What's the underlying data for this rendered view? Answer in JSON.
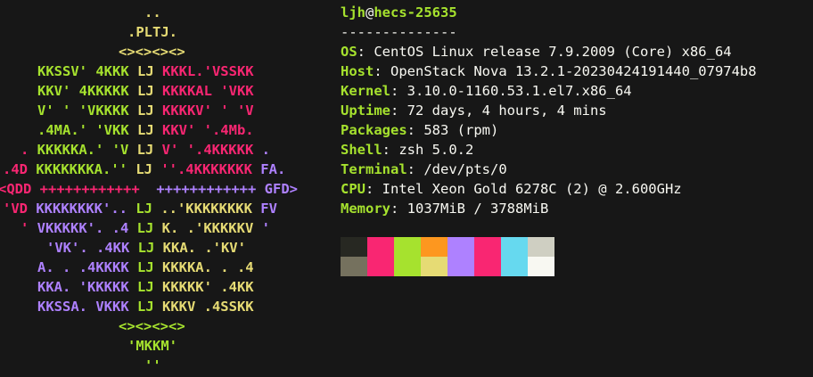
{
  "logo": {
    "lines": [
      {
        "parts": [
          {
            "t": "..",
            "c": "y"
          }
        ]
      },
      {
        "parts": [
          {
            "t": ".PLTJ.",
            "c": "y"
          }
        ]
      },
      {
        "parts": [
          {
            "t": "<><><><>",
            "c": "y"
          }
        ]
      },
      {
        "parts": [
          {
            "t": "KKSSV' 4KKK ",
            "c": "g"
          },
          {
            "t": "LJ ",
            "c": "y"
          },
          {
            "t": "KKKL.'VSSKK",
            "c": "p"
          }
        ]
      },
      {
        "parts": [
          {
            "t": "KKV' 4KKKKK ",
            "c": "g"
          },
          {
            "t": "LJ ",
            "c": "y"
          },
          {
            "t": "KKKKAL 'VKK",
            "c": "p"
          }
        ]
      },
      {
        "parts": [
          {
            "t": "V' ' 'VKKKK ",
            "c": "g"
          },
          {
            "t": "LJ ",
            "c": "y"
          },
          {
            "t": "KKKKV' ' 'V",
            "c": "p"
          }
        ]
      },
      {
        "parts": [
          {
            "t": ".4MA.' 'VKK ",
            "c": "g"
          },
          {
            "t": "LJ ",
            "c": "y"
          },
          {
            "t": "KKV' '.4Mb.",
            "c": "p"
          }
        ]
      },
      {
        "parts": [
          {
            "t": ". ",
            "c": "p"
          },
          {
            "t": "KKKKKA.' 'V ",
            "c": "g"
          },
          {
            "t": "LJ ",
            "c": "y"
          },
          {
            "t": "V' '.4KKKKK ",
            "c": "p"
          },
          {
            "t": ".",
            "c": "v"
          }
        ]
      },
      {
        "parts": [
          {
            "t": ".4D ",
            "c": "p"
          },
          {
            "t": "KKKKKKKA.'' ",
            "c": "g"
          },
          {
            "t": "LJ ",
            "c": "y"
          },
          {
            "t": "''.4KKKKKKK ",
            "c": "p"
          },
          {
            "t": "FA.",
            "c": "v"
          }
        ]
      },
      {
        "parts": [
          {
            "t": "<QDD ",
            "c": "p"
          },
          {
            "t": "++++++++++++  ",
            "c": "p"
          },
          {
            "t": "++++++++++++ ",
            "c": "v"
          },
          {
            "t": "GFD>",
            "c": "v"
          }
        ]
      },
      {
        "parts": [
          {
            "t": "'VD ",
            "c": "p"
          },
          {
            "t": "KKKKKKKK'.. ",
            "c": "v"
          },
          {
            "t": "LJ ",
            "c": "g"
          },
          {
            "t": "..'KKKKKKKK ",
            "c": "y"
          },
          {
            "t": "FV",
            "c": "v"
          }
        ]
      },
      {
        "parts": [
          {
            "t": "' ",
            "c": "p"
          },
          {
            "t": "VKKKKK'. .4 ",
            "c": "v"
          },
          {
            "t": "LJ ",
            "c": "g"
          },
          {
            "t": "K. .'KKKKKV ",
            "c": "y"
          },
          {
            "t": "'",
            "c": "v"
          }
        ]
      },
      {
        "parts": [
          {
            "t": "'VK'. .4KK ",
            "c": "v"
          },
          {
            "t": "LJ ",
            "c": "g"
          },
          {
            "t": "KKA. .'KV'",
            "c": "y"
          }
        ]
      },
      {
        "parts": [
          {
            "t": "A. . .4KKKK ",
            "c": "v"
          },
          {
            "t": "LJ ",
            "c": "g"
          },
          {
            "t": "KKKKA. . .4",
            "c": "y"
          }
        ]
      },
      {
        "parts": [
          {
            "t": "KKA. 'KKKKK ",
            "c": "v"
          },
          {
            "t": "LJ ",
            "c": "g"
          },
          {
            "t": "KKKKK' .4KK",
            "c": "y"
          }
        ]
      },
      {
        "parts": [
          {
            "t": "KKSSA. VKKK ",
            "c": "v"
          },
          {
            "t": "LJ ",
            "c": "g"
          },
          {
            "t": "KKKV .4SSKK",
            "c": "y"
          }
        ]
      },
      {
        "parts": [
          {
            "t": "<><><><>",
            "c": "g"
          }
        ]
      },
      {
        "parts": [
          {
            "t": "'MKKM'",
            "c": "g"
          }
        ]
      },
      {
        "parts": [
          {
            "t": "''",
            "c": "g"
          }
        ]
      }
    ]
  },
  "info": {
    "user": "ljh",
    "at": "@",
    "host": "hecs-25635",
    "separator": "--------------",
    "fields": [
      {
        "key": "OS",
        "value": "CentOS Linux release 7.9.2009 (Core) x86_64"
      },
      {
        "key": "Host",
        "value": "OpenStack Nova 13.2.1-20230424191440_07974b8"
      },
      {
        "key": "Kernel",
        "value": "3.10.0-1160.53.1.el7.x86_64"
      },
      {
        "key": "Uptime",
        "value": "72 days, 4 hours, 4 mins"
      },
      {
        "key": "Packages",
        "value": "583 (rpm)"
      },
      {
        "key": "Shell",
        "value": "zsh 5.0.2"
      },
      {
        "key": "Terminal",
        "value": "/dev/pts/0"
      },
      {
        "key": "CPU",
        "value": "Intel Xeon Gold 6278C (2) @ 2.600GHz"
      },
      {
        "key": "Memory",
        "value": "1037MiB / 3788MiB"
      }
    ]
  },
  "palette": {
    "rows": [
      [
        "#272822",
        "#f92672",
        "#a6e22e",
        "#fd971f",
        "#ae81ff",
        "#f92672",
        "#66d9ef",
        "#cfcfc2"
      ],
      [
        "#75715e",
        "#f92672",
        "#a6e22e",
        "#e6db74",
        "#ae81ff",
        "#f92672",
        "#66d9ef",
        "#f8f8f2"
      ]
    ]
  }
}
